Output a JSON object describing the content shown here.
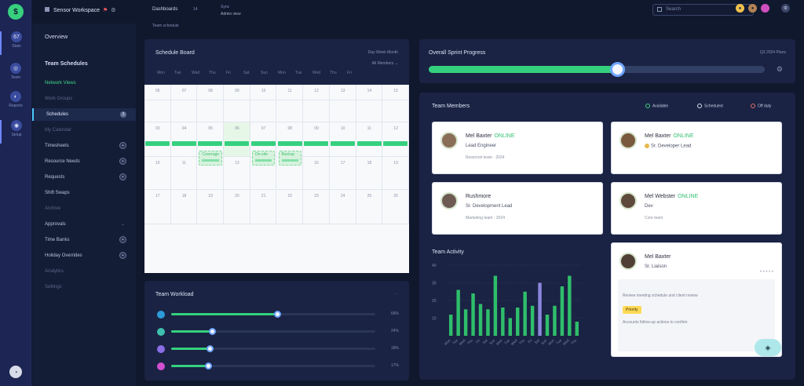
{
  "rail": {
    "logo": "$",
    "items": [
      {
        "icon": "grid-icon",
        "glyph": "67",
        "label": "Stats",
        "active": true
      },
      {
        "icon": "user-icon",
        "glyph": "◎",
        "label": "Team"
      },
      {
        "icon": "chart-icon",
        "glyph": "◐",
        "label": "Reports"
      },
      {
        "icon": "settings-icon",
        "glyph": "◉",
        "label": "Setup",
        "active": true
      }
    ],
    "me": "◔"
  },
  "topbar": {
    "crumb": "Sensor Workspace",
    "flag": "⚑",
    "gear": "⚙",
    "title": "Dashboards",
    "num": "14",
    "sub": "Team schedule",
    "mini1": "Sync",
    "mini2": "Admin view",
    "search_placeholder": "Search"
  },
  "sidenav": {
    "head": "Overview",
    "group": "Team Schedules",
    "items": [
      {
        "label": "Network Views",
        "style": "green"
      },
      {
        "label": "Work Groups",
        "style": "dim"
      },
      {
        "label": "Schedules",
        "style": "active",
        "badge": "3"
      },
      {
        "label": "My Calendar",
        "style": "dim"
      },
      {
        "label": "Timesheets",
        "badge": "•"
      },
      {
        "label": "Resource Needs",
        "badge": "•"
      },
      {
        "label": "Requests",
        "badge": "•"
      },
      {
        "label": "Shift Swaps",
        "style": ""
      },
      {
        "label": "Archive",
        "style": "dim"
      },
      {
        "label": "Approvals",
        "chev": "⌄"
      },
      {
        "label": "Time Banks",
        "badge": "•"
      },
      {
        "label": "Holiday Overrides",
        "badge": "•"
      },
      {
        "label": "Analytics",
        "style": "dim"
      },
      {
        "label": "Settings",
        "style": "dim"
      }
    ]
  },
  "calendar": {
    "title": "Schedule Board",
    "link1": "Day  Week  Month",
    "link2": "All Members ⌄",
    "days": [
      "Mon",
      "Tue",
      "Wed",
      "Thu",
      "Fri",
      "Sat",
      "Sun",
      "Mon",
      "Tue",
      "Wed",
      "Thu",
      "Fri"
    ],
    "rows": [
      [
        "06",
        "07",
        "08",
        "09",
        "10",
        "11",
        "12",
        "13",
        "14",
        "15"
      ],
      [
        "",
        "",
        "",
        "",
        "",
        "",
        "",
        "",
        "",
        ""
      ],
      [
        "03",
        "04",
        "05",
        "06",
        "07",
        "08",
        "09",
        "10",
        "11",
        "12"
      ],
      [
        "10",
        "11",
        "12",
        "13",
        "14",
        "15",
        "16",
        "17",
        "18",
        "19"
      ],
      [
        "17",
        "18",
        "19",
        "20",
        "21",
        "22",
        "23",
        "24",
        "25",
        "26"
      ]
    ],
    "events": [
      {
        "text": "Coverage"
      },
      {
        "text": "On-site"
      },
      {
        "text": "Backup"
      }
    ]
  },
  "workload": {
    "title": "Team Workload",
    "icon": "⋯",
    "rows": [
      {
        "color": "#2d9bd8",
        "value": "68%",
        "fraction": 0.52
      },
      {
        "color": "#3fbfae",
        "value": "24%",
        "fraction": 0.2
      },
      {
        "color": "#8a6ee6",
        "value": "18%",
        "fraction": 0.19
      },
      {
        "color": "#d24fd0",
        "value": "17%",
        "fraction": 0.18
      }
    ]
  },
  "progress": {
    "title": "Overall Sprint Progress",
    "range": "Q3  2024  Plans",
    "fraction": 0.56,
    "gear": "⚙"
  },
  "team": {
    "title": "Team Members",
    "legend": [
      {
        "label": "Available"
      },
      {
        "label": "Scheduled"
      },
      {
        "label": "Off duty"
      }
    ],
    "cards": [
      {
        "name": "Mel Baxter",
        "tag": "ONLINE",
        "role": "Lead Engineer",
        "meta": "Reservoir team   ·   2024"
      },
      {
        "name": "Mel Baxter",
        "tag": "ONLINE",
        "role": "Sr. Developer Lead",
        "meta": ""
      },
      {
        "name": "Rushmore",
        "tag": "",
        "role": "Sr. Development Lead",
        "meta": "Marketing team · 2024"
      },
      {
        "name": "Mel Webster",
        "tag": "ONLINE",
        "role": "Dev",
        "meta": "Core team"
      },
      {
        "name": "Mel Baxter",
        "tag": "",
        "role": "Sr. Liaison",
        "meta": "",
        "desc1": "Review meeting schedule and client review",
        "badge": "Priority",
        "desc2": "Accounts follow-up actions to confirm"
      }
    ],
    "fab": "◈"
  },
  "chart_data": {
    "type": "bar",
    "title": "Team Activity",
    "ylabels": [
      "40",
      "30",
      "20",
      "10"
    ],
    "categories": [
      "Mon",
      "Tue",
      "Wed",
      "Thu",
      "Fri",
      "Sat",
      "Sun",
      "Mon",
      "Tue",
      "Wed",
      "Thu",
      "Fri",
      "Sat",
      "Sun",
      "Mon",
      "Tue",
      "Wed",
      "Thu"
    ],
    "values": [
      12,
      26,
      15,
      24,
      18,
      15,
      34,
      16,
      10,
      16,
      25,
      17,
      30,
      12,
      17,
      28,
      34,
      8
    ],
    "highlight_index": 12,
    "ylim": [
      0,
      40
    ],
    "colors": {
      "bar": "#2fbe6b",
      "highlight": "#8c86de"
    }
  }
}
